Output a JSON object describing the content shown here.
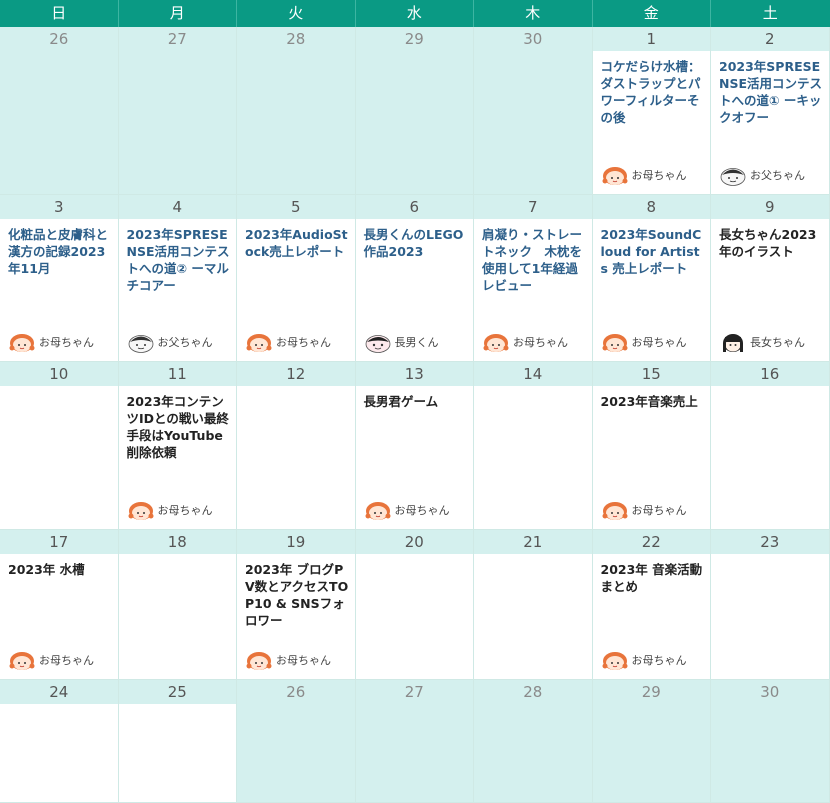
{
  "weekdays": [
    "日",
    "月",
    "火",
    "水",
    "木",
    "金",
    "土"
  ],
  "colors": {
    "header": "#0a9a84",
    "out_of_month": "#d4f0ee",
    "link": "#2d5f8a"
  },
  "weeks": [
    {
      "days": [
        {
          "date": "26",
          "out": true
        },
        {
          "date": "27",
          "out": true
        },
        {
          "date": "28",
          "out": true
        },
        {
          "date": "29",
          "out": true
        },
        {
          "date": "30",
          "out": true
        },
        {
          "date": "1",
          "post": {
            "title": "コケだらけ水槽：ダストラップとパワーフィルターその後",
            "author": "お母ちゃん",
            "avatar": "mother-avatar-icon"
          }
        },
        {
          "date": "2",
          "post": {
            "title": "2023年SPRESENSE活用コンテストへの道① ーキックオフー",
            "author": "お父ちゃん",
            "avatar": "father-avatar-icon"
          }
        }
      ]
    },
    {
      "days": [
        {
          "date": "3",
          "post": {
            "title": "化粧品と皮膚科と漢方の記録2023年11月",
            "author": "お母ちゃん",
            "avatar": "mother-avatar-icon"
          }
        },
        {
          "date": "4",
          "post": {
            "title": "2023年SPRESENSE活用コンテストへの道② ーマルチコアー",
            "author": "お父ちゃん",
            "avatar": "father-avatar-icon"
          }
        },
        {
          "date": "5",
          "post": {
            "title": "2023年AudioStock売上レポート",
            "author": "お母ちゃん",
            "avatar": "mother-avatar-icon"
          }
        },
        {
          "date": "6",
          "post": {
            "title": "長男くんのLEGO作品2023",
            "author": "長男くん",
            "avatar": "son-avatar-icon"
          }
        },
        {
          "date": "7",
          "post": {
            "title": "肩凝り・ストレートネック　木枕を使用して1年経過レビュー",
            "author": "お母ちゃん",
            "avatar": "mother-avatar-icon"
          }
        },
        {
          "date": "8",
          "post": {
            "title": "2023年SoundCloud for Artists 売上レポート",
            "author": "お母ちゃん",
            "avatar": "mother-avatar-icon"
          }
        },
        {
          "date": "9",
          "post": {
            "title": "長女ちゃん2023年のイラスト",
            "author": "長女ちゃん",
            "avatar": "daughter-avatar-icon",
            "dark": true
          }
        }
      ]
    },
    {
      "days": [
        {
          "date": "10"
        },
        {
          "date": "11",
          "post": {
            "title": "2023年コンテンツIDとの戦い最終手段はYouTube削除依頼",
            "author": "お母ちゃん",
            "avatar": "mother-avatar-icon",
            "dark": true
          }
        },
        {
          "date": "12"
        },
        {
          "date": "13",
          "post": {
            "title": "長男君ゲーム",
            "author": "お母ちゃん",
            "avatar": "mother-avatar-icon",
            "dark": true
          }
        },
        {
          "date": "14"
        },
        {
          "date": "15",
          "post": {
            "title": "2023年音楽売上",
            "author": "お母ちゃん",
            "avatar": "mother-avatar-icon",
            "dark": true
          }
        },
        {
          "date": "16"
        }
      ]
    },
    {
      "days": [
        {
          "date": "17",
          "post": {
            "title": "2023年 水槽",
            "author": "お母ちゃん",
            "avatar": "mother-avatar-icon",
            "dark": true
          }
        },
        {
          "date": "18"
        },
        {
          "date": "19",
          "post": {
            "title": "2023年 ブログPV数とアクセスTOP10 & SNSフォロワー",
            "author": "お母ちゃん",
            "avatar": "mother-avatar-icon",
            "dark": true
          }
        },
        {
          "date": "20"
        },
        {
          "date": "21"
        },
        {
          "date": "22",
          "post": {
            "title": "2023年 音楽活動まとめ",
            "author": "お母ちゃん",
            "avatar": "mother-avatar-icon",
            "dark": true
          }
        },
        {
          "date": "23"
        }
      ]
    },
    {
      "days": [
        {
          "date": "24"
        },
        {
          "date": "25"
        },
        {
          "date": "26",
          "out": true
        },
        {
          "date": "27",
          "out": true
        },
        {
          "date": "28",
          "out": true
        },
        {
          "date": "29",
          "out": true
        },
        {
          "date": "30",
          "out": true
        }
      ]
    }
  ]
}
